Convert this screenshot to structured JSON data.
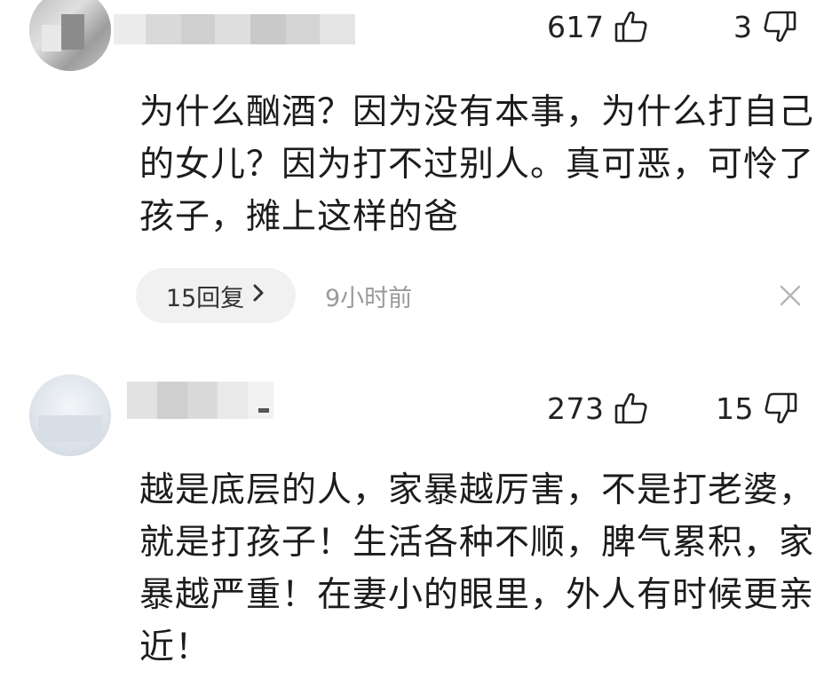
{
  "comments": [
    {
      "likes": "617",
      "dislikes": "3",
      "text": "为什么酗酒？因为没有本事，为什么打自己的女儿？因为打不过别人。真可恶，可怜了孩子，摊上这样的爸",
      "replies_label": "15回复",
      "time": "9小时前"
    },
    {
      "likes": "273",
      "dislikes": "15",
      "text": "越是底层的人，家暴越厉害，不是打老婆，就是打孩子！生活各种不顺，脾气累积，家暴越严重！在妻小的眼里，外人有时候更亲近！"
    }
  ],
  "icons": {
    "like": "thumbs-up-icon",
    "dislike": "thumbs-down-icon",
    "reply_arrow": "chevron-right-icon",
    "close": "close-icon"
  },
  "colors": {
    "text": "#1c1c1c",
    "muted": "#9a9a9a",
    "pill_bg": "#f1f1f1"
  }
}
